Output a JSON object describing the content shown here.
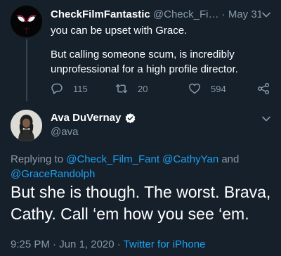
{
  "tweet1": {
    "display_name": "CheckFilmFantastic",
    "handle": "@Check_Fi…",
    "separator": "·",
    "date": "May 31",
    "paragraph1": "you can be upset with Grace.",
    "paragraph2": "But calling someone scum, is incredibly unprofessional for a high profile director.",
    "reply_count": "115",
    "retweet_count": "20",
    "like_count": "594"
  },
  "tweet2": {
    "display_name": "Ava DuVernay",
    "handle": "@ava",
    "replying_prefix": "Replying to",
    "mentions": [
      "@Check_Film_Fant",
      "@CathyYan",
      "@GraceRandolph"
    ],
    "and_word": "and",
    "text": "But she is though. The worst. Brava, Cathy. Call ‘em how you see ‘em.",
    "time": "9:25 PM",
    "separator": "·",
    "date": "Jun 1, 2020",
    "separator2": "·",
    "source": "Twitter for iPhone"
  },
  "colors": {
    "background": "#15202b",
    "secondary_text": "#8899a6",
    "link": "#1da1f2",
    "verified": "#ffffff"
  },
  "icons": [
    "spider-mask-avatar",
    "chevron-down-icon",
    "reply-icon",
    "retweet-icon",
    "like-icon",
    "share-icon",
    "verified-badge-icon"
  ]
}
